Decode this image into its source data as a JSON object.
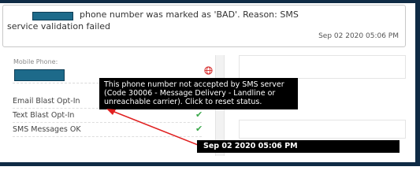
{
  "notice": {
    "message": "phone number was marked as 'BAD'. Reason: SMS service validation failed",
    "timestamp": "Sep 02 2020 05:06 PM"
  },
  "form": {
    "mobile_label": "Mobile Phone:",
    "options": [
      {
        "label": "Email Blast Opt-In",
        "checked": false
      },
      {
        "label": "Text Blast Opt-In",
        "checked": true
      },
      {
        "label": "SMS Messages OK",
        "checked": true
      }
    ]
  },
  "tooltip": {
    "text": "This phone number not accepted by SMS server (Code 30006 - Message Delivery - Landline or unreachable carrier). Click to reset status."
  },
  "annotation": {
    "timestamp": "Sep 02 2020 05:06 PM"
  },
  "icons": {
    "status": "globe-icon",
    "check": "check-icon"
  },
  "colors": {
    "frame": "#0f2b45",
    "redaction": "#1d6a8a",
    "status_icon": "#d62b2b",
    "check": "#3aa84a",
    "arrow": "#e02020",
    "tooltip_bg": "#000000"
  }
}
